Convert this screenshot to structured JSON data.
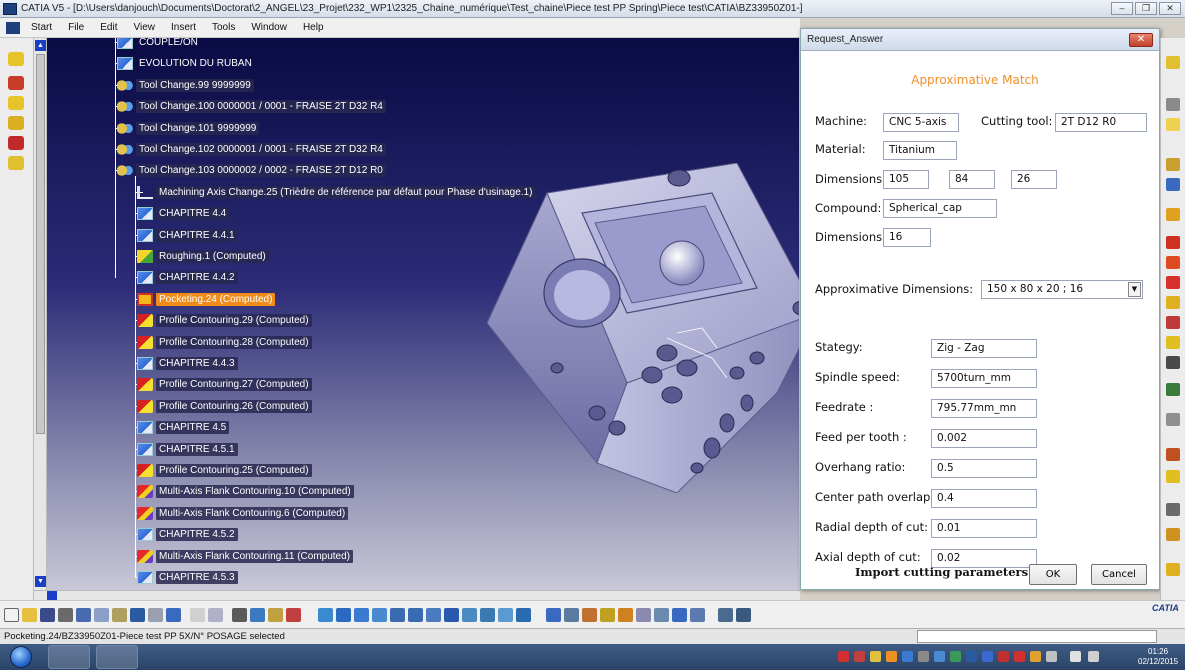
{
  "window": {
    "title": "CATIA V5 - [D:\\Users\\danjouch\\Documents\\Doctorat\\2_ANGEL\\23_Projet\\232_WP1\\2325_Chaine_numérique\\Test_chaine\\Piece test PP Spring\\Piece test\\CATIA\\BZ33950Z01-]"
  },
  "menu": [
    "Start",
    "File",
    "Edit",
    "View",
    "Insert",
    "Tools",
    "Window",
    "Help"
  ],
  "tree": [
    {
      "label": "COUPLE/ON",
      "icon": "chapter-icon"
    },
    {
      "label": "EVOLUTION DU RUBAN",
      "icon": "chapter-icon"
    },
    {
      "label": "Tool Change.99  9999999",
      "icon": "tool-change-icon"
    },
    {
      "label": "Tool Change.100  0000001 / 0001 - FRAISE 2T D32 R4",
      "icon": "tool-change-icon"
    },
    {
      "label": "Tool Change.101  9999999",
      "icon": "tool-change-icon"
    },
    {
      "label": "Tool Change.102  0000001 / 0001 - FRAISE 2T D32 R4",
      "icon": "tool-change-icon"
    },
    {
      "label": "Tool Change.103  0000002 / 0002 - FRAISE 2T D12 R0",
      "icon": "tool-change-icon"
    },
    {
      "label": "Machining Axis Change.25 (Trièdre de référence par défaut pour Phase d'usinage.1)",
      "icon": "axis-icon"
    },
    {
      "label": "CHAPITRE 4.4",
      "icon": "chapter-icon"
    },
    {
      "label": "CHAPITRE 4.4.1",
      "icon": "chapter-icon"
    },
    {
      "label": "Roughing.1 (Computed)",
      "icon": "roughing-icon"
    },
    {
      "label": "CHAPITRE 4.4.2",
      "icon": "chapter-icon"
    },
    {
      "label": "Pocketing.24 (Computed)",
      "icon": "pocketing-icon"
    },
    {
      "label": "Profile Contouring.29 (Computed)",
      "icon": "profile-icon"
    },
    {
      "label": "Profile Contouring.28 (Computed)",
      "icon": "profile-icon"
    },
    {
      "label": "CHAPITRE 4.4.3",
      "icon": "chapter-icon"
    },
    {
      "label": "Profile Contouring.27 (Computed)",
      "icon": "profile-icon"
    },
    {
      "label": "Profile Contouring.26 (Computed)",
      "icon": "profile-icon"
    },
    {
      "label": "CHAPITRE 4.5",
      "icon": "chapter-icon"
    },
    {
      "label": "CHAPITRE 4.5.1",
      "icon": "chapter-icon"
    },
    {
      "label": "Profile Contouring.25 (Computed)",
      "icon": "profile-icon"
    },
    {
      "label": "Multi-Axis Flank Contouring.10 (Computed)",
      "icon": "flank-icon"
    },
    {
      "label": "Multi-Axis Flank Contouring.6 (Computed)",
      "icon": "flank-icon"
    },
    {
      "label": "CHAPITRE 4.5.2",
      "icon": "chapter-icon"
    },
    {
      "label": "Multi-Axis Flank Contouring.11 (Computed)",
      "icon": "flank-icon"
    },
    {
      "label": "CHAPITRE 4.5.3",
      "icon": "chapter-icon"
    }
  ],
  "selected_tree_label": "Pocketing.24 (Computed)",
  "dialog": {
    "title": "Request_Answer",
    "close_label": "✕",
    "heading": "Approximative Match",
    "machine_label": "Machine:",
    "machine_value": "CNC 5-axis",
    "cutting_tool_label": "Cutting tool:",
    "cutting_tool_value": "2T D12 R0",
    "material_label": "Material:",
    "material_value": "Titanium",
    "dimensions_label": "Dimensions:",
    "dim1": "105",
    "dim2": "84",
    "dim3": "26",
    "compound_label": "Compound:",
    "compound_value": "Spherical_cap",
    "dimensions2_label": "Dimensions:",
    "dim4": "16",
    "approx_dims_label": "Approximative Dimensions:",
    "approx_dims_value": "150 x 80 x 20 ; 16",
    "params": [
      {
        "label": "Stategy:",
        "value": "Zig - Zag"
      },
      {
        "label": "Spindle speed:",
        "value": "5700turn_mm"
      },
      {
        "label": "Feedrate :",
        "value": "795.77mm_mn"
      },
      {
        "label": "Feed per tooth :",
        "value": "0.002"
      },
      {
        "label": "Overhang ratio:",
        "value": "0.5"
      },
      {
        "label": "Center path overlap:",
        "value": "0.4"
      },
      {
        "label": "Radial depth of cut:",
        "value": "0.01"
      },
      {
        "label": "Axial depth of cut:",
        "value": "0.02"
      }
    ],
    "import_question": "Import cutting parameters ?",
    "ok_label": "OK",
    "cancel_label": "Cancel"
  },
  "status": {
    "text": "Pocketing.24/BZ33950Z01-Piece test PP 5X/N° POSAGE selected"
  },
  "taskbar": {
    "time": "01:26",
    "date": "02/12/2015"
  },
  "logo": {
    "catia": "CATIA"
  },
  "colors": {
    "accent": "#f0902a",
    "selected": "#f08a18",
    "viewport_top": "#0a0a44",
    "viewport_bottom": "#c8c8d8"
  }
}
